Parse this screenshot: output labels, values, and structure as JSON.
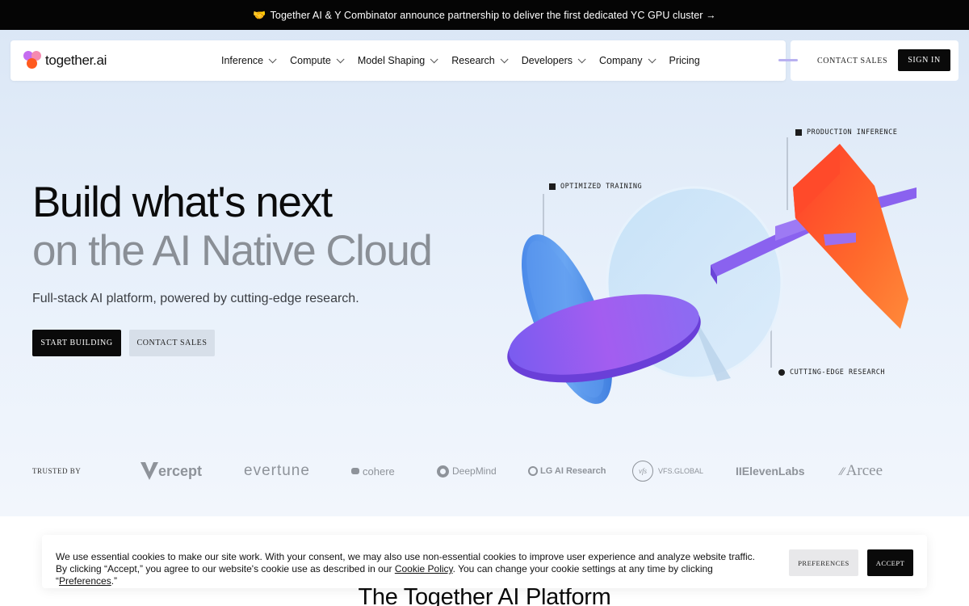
{
  "announcement": {
    "icon": "handshake-icon",
    "text": "Together AI & Y Combinator announce partnership to deliver the first dedicated YC GPU cluster →"
  },
  "logo": {
    "text": "together.ai",
    "colors": [
      "#f35c8a",
      "#9b59f0",
      "#ff7a1a"
    ]
  },
  "nav": {
    "items": [
      {
        "label": "Inference",
        "dropdown": true
      },
      {
        "label": "Compute",
        "dropdown": true
      },
      {
        "label": "Model Shaping",
        "dropdown": true
      },
      {
        "label": "Research",
        "dropdown": true
      },
      {
        "label": "Developers",
        "dropdown": true
      },
      {
        "label": "Company",
        "dropdown": true
      },
      {
        "label": "Pricing",
        "dropdown": false
      }
    ],
    "contact_label": "CONTACT SALES",
    "signin_label": "SIGN IN"
  },
  "hero": {
    "title_line1": "Build what's next",
    "title_line2": "on the AI Native Cloud",
    "subtitle": "Full-stack AI platform, powered by cutting-edge research.",
    "primary_cta": "START BUILDING",
    "secondary_cta": "CONTACT SALES",
    "labels": {
      "training": "OPTIMIZED TRAINING",
      "inference": "PRODUCTION INFERENCE",
      "research": "CUTTING-EDGE RESEARCH"
    }
  },
  "trusted": {
    "label": "TRUSTED BY",
    "logos": {
      "vercept": "ercept",
      "evertune": "evertune",
      "cohere": "cohere",
      "deepmind": "DeepMind",
      "lg": "LG AI Research",
      "vfs": "VFS.GLOBAL",
      "vfs_badge": "vfs",
      "elevenlabs": "IIElevenLabs",
      "arcee": "Arcee"
    }
  },
  "cookie": {
    "text_before": "We use essential cookies to make our site work. With your consent, we may also use non-essential cookies to improve user experience and analyze website traffic. By clicking “Accept,” you agree to our website's cookie use as described in our ",
    "policy_link": "Cookie Policy",
    "text_middle": ". You can change your cookie settings at any time by clicking “",
    "preferences_link": "Preferences",
    "text_end": ".”",
    "preferences_btn": "PREFERENCES",
    "accept_btn": "ACCEPT"
  },
  "platform": {
    "title": "The Together AI Platform"
  },
  "colors": {
    "accent_dark": "#0a0a0a",
    "hero_bg": "#e4edf8",
    "title_gray": "#8a8f96",
    "purple": "#8a4ff0",
    "orange": "#ff5a1f",
    "blue": "#3b7fe0"
  }
}
